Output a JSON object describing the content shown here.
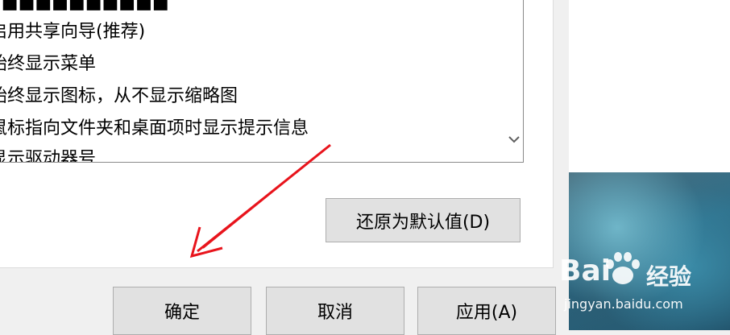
{
  "options_list": {
    "items": [
      "启用共享向导(推荐)",
      "始终显示菜单",
      "始终显示图标，从不显示缩略图",
      "鼠标指向文件夹和桌面项时显示提示信息",
      "显示驱动器号"
    ]
  },
  "buttons": {
    "restore_defaults": "还原为默认值(D)",
    "ok": "确定",
    "cancel": "取消",
    "apply": "应用(A)"
  },
  "watermark": {
    "brand_text": "Bai",
    "suffix": "经验",
    "url": "jingyan.baidu.com"
  },
  "colors": {
    "annotation_arrow": "#e8141c"
  }
}
